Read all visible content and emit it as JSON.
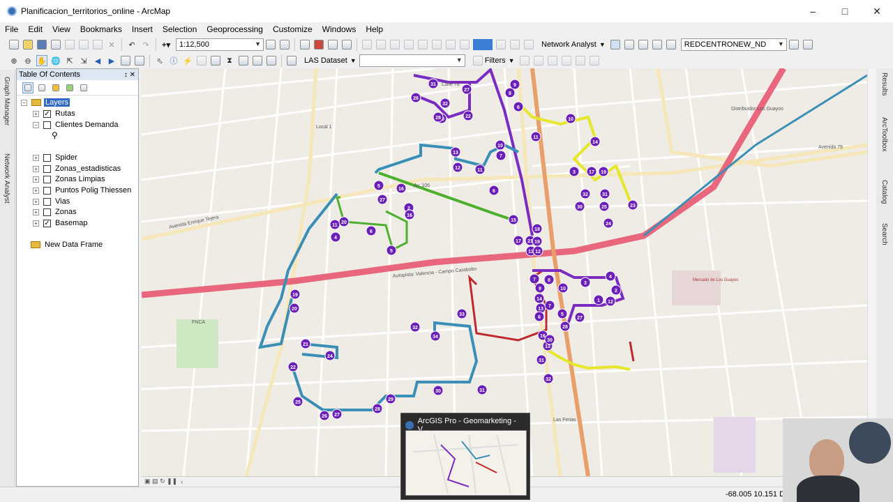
{
  "window": {
    "title": "Planificacion_territorios_online - ArcMap"
  },
  "menu": [
    "File",
    "Edit",
    "View",
    "Bookmarks",
    "Insert",
    "Selection",
    "Geoprocessing",
    "Customize",
    "Windows",
    "Help"
  ],
  "toolbar": {
    "scale": "1:12,500",
    "network_analyst": "Network Analyst",
    "network_dataset": "REDCENTRONEW_ND",
    "las_dataset": "LAS Dataset",
    "filters": "Filters"
  },
  "left_tabs": [
    "Graph Manager",
    "Network Analyst"
  ],
  "right_tabs": [
    "Results",
    "ArcToolbox",
    "Catalog",
    "Search"
  ],
  "toc": {
    "title": "Table Of Contents",
    "root": "Layers",
    "layers": [
      {
        "name": "Rutas",
        "checked": true
      },
      {
        "name": "Clientes Demanda",
        "checked": false
      },
      {
        "name": "Spider",
        "checked": false
      },
      {
        "name": "Zonas_estadisticas",
        "checked": false
      },
      {
        "name": "Zonas Limpias",
        "checked": false
      },
      {
        "name": "Puntos Polig Thiessen",
        "checked": false
      },
      {
        "name": "Vias",
        "checked": false
      },
      {
        "name": "Zonas",
        "checked": false
      },
      {
        "name": "Basemap",
        "checked": true
      }
    ],
    "new_frame": "New Data Frame"
  },
  "map": {
    "labels": [
      "Autopista: Valencia - Campo Carabobo",
      "Avenida Enrique Tejera",
      "Local 1",
      "Av. 106",
      "Las Ferias",
      "Distribuidor Los Guayos",
      "Mercado de Los Guayos",
      "FNCA",
      "Avenida 79",
      "Calle 78"
    ],
    "route_colors": {
      "purple": "#7a2cc2",
      "blue": "#3a8fb7",
      "green": "#4caf2d",
      "yellow": "#e6e62a",
      "red": "#c0272d",
      "highway": "#e8677c"
    },
    "stops_purple": [
      "31",
      "26",
      "32",
      "30",
      "28",
      "27",
      "22",
      "8",
      "6",
      "9",
      "10",
      "11",
      "14",
      "13",
      "12",
      "11",
      "10",
      "7",
      "6",
      "5",
      "16",
      "27",
      "2",
      "16",
      "3",
      "17",
      "19",
      "32",
      "31",
      "30",
      "25",
      "24",
      "23",
      "15",
      "18",
      "17",
      "21",
      "19",
      "13",
      "12",
      "11",
      "20",
      "4",
      "6",
      "5",
      "8",
      "7",
      "9",
      "10",
      "3",
      "4",
      "2",
      "1",
      "12",
      "14",
      "13",
      "7",
      "6",
      "5",
      "28",
      "27",
      "16",
      "13",
      "30",
      "31",
      "32",
      "19",
      "20",
      "21",
      "24",
      "22",
      "25",
      "26",
      "27",
      "28",
      "29",
      "30",
      "31",
      "32",
      "34",
      "33"
    ]
  },
  "taskbar_popup": {
    "title": "ArcGIS Pro - Geomarketing - V..."
  },
  "status": {
    "coords": "-68.005  10.151 De"
  }
}
